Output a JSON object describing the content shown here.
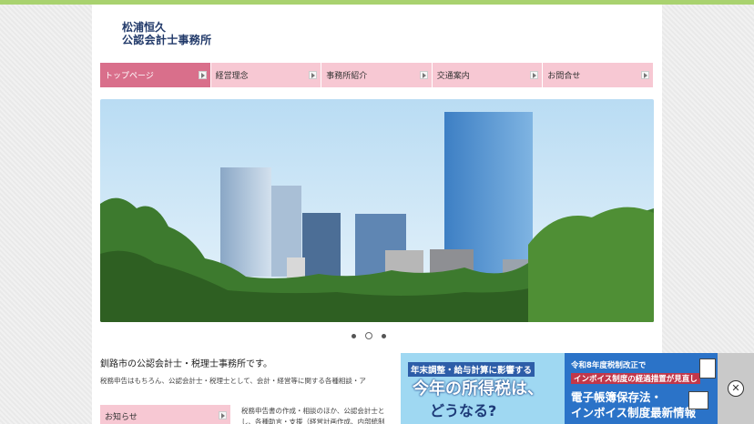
{
  "logo": {
    "line1": "松浦恒久",
    "line2": "公認会計士事務所"
  },
  "nav": {
    "items": [
      {
        "label": "トップページ",
        "active": true
      },
      {
        "label": "経営理念",
        "active": false
      },
      {
        "label": "事務所紹介",
        "active": false
      },
      {
        "label": "交通案内",
        "active": false
      },
      {
        "label": "お問合せ",
        "active": false
      }
    ]
  },
  "slider": {
    "dot_count": 3,
    "active_index": 1
  },
  "intro": {
    "heading": "釧路市の公認会計士・税理士事務所です。",
    "text": "税務申告はもちろん、公認会計士・税理士として、会計・経営等に関する各種相談・ア"
  },
  "news_box": {
    "label": "お知らせ"
  },
  "column": {
    "line1": "税務申告書の作成・相談のほか、公認会計士と",
    "line2": "し、各種助言・支援（経営計画作成、内部統制"
  },
  "ad": {
    "left_head": "年末調整・給与計算に影響する",
    "left_big1": "今年の所得税は、",
    "left_big2": "どうなる?",
    "right_line1": "令和8年度税制改正で",
    "right_line2": "インボイス制度の経過措置が見直し",
    "right_line3": "電子帳簿保存法・",
    "right_line4": "インボイス制度最新情報",
    "close_symbol": "✕"
  },
  "colors": {
    "accent_bar": "#a9d26f",
    "nav_bg": "#f7c8d3",
    "nav_active": "#d96f8b",
    "logo_text": "#223a6a"
  }
}
